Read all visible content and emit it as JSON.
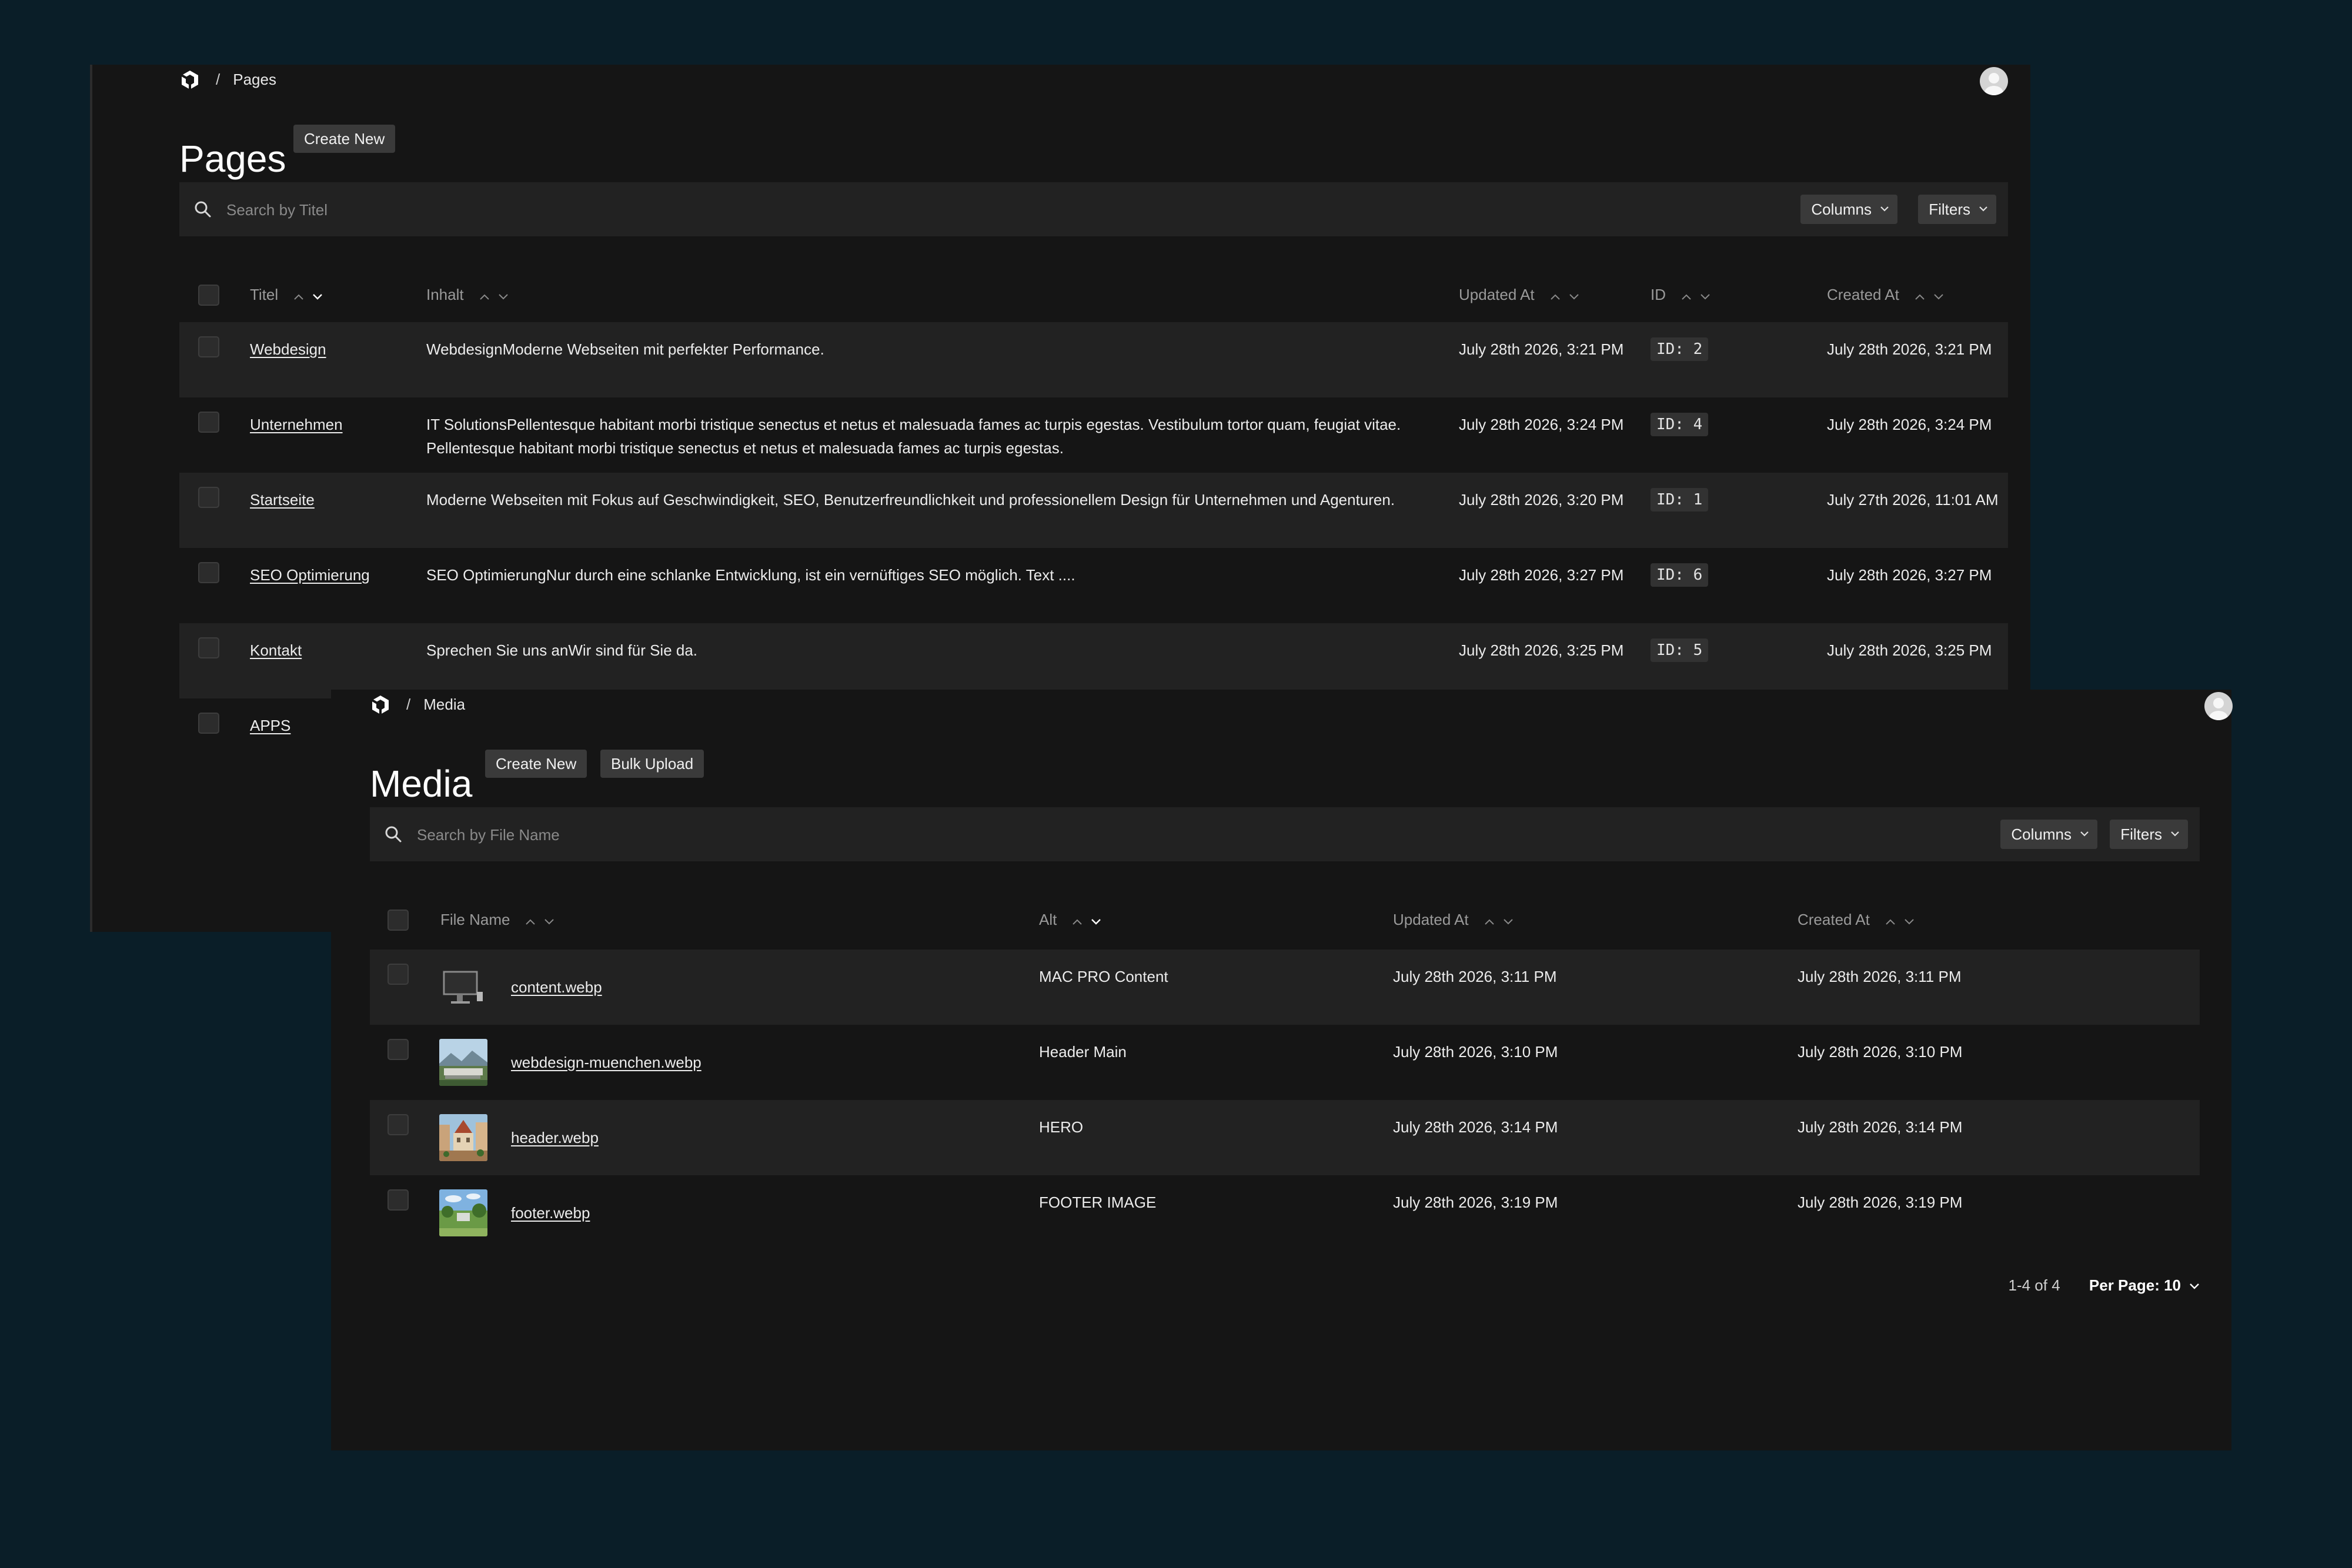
{
  "colors": {
    "background": "#0a1e28",
    "window": "#151515",
    "row_alt": "#222222",
    "button": "#3a3a3a",
    "muted_text": "#9a9a9a"
  },
  "pages": {
    "breadcrumb": {
      "separator": "/",
      "current": "Pages"
    },
    "title": "Pages",
    "create_label": "Create New",
    "search_placeholder": "Search by Titel",
    "columns_label": "Columns",
    "filters_label": "Filters",
    "headers": {
      "titel": "Titel",
      "inhalt": "Inhalt",
      "updated": "Updated At",
      "id": "ID",
      "created": "Created At"
    },
    "rows": [
      {
        "titel": "Webdesign",
        "inhalt": "WebdesignModerne Webseiten mit perfekter Performance.",
        "updated": "July 28th 2026, 3:21 PM",
        "id": "ID: 2",
        "created": "July 28th 2026, 3:21 PM"
      },
      {
        "titel": "Unternehmen",
        "inhalt": "IT SolutionsPellentesque habitant morbi tristique senectus et netus et malesuada fames ac turpis egestas. Vestibulum tortor quam, feugiat vitae. Pellentesque habitant morbi tristique senectus et netus et malesuada fames ac turpis egestas.",
        "updated": "July 28th 2026, 3:24 PM",
        "id": "ID: 4",
        "created": "July 28th 2026, 3:24 PM"
      },
      {
        "titel": "Startseite",
        "inhalt": "Moderne Webseiten mit Fokus auf Geschwindigkeit, SEO, Benutzerfreundlichkeit und professionellem Design für Unternehmen und Agenturen.",
        "updated": "July 28th 2026, 3:20 PM",
        "id": "ID: 1",
        "created": "July 27th 2026, 11:01 AM"
      },
      {
        "titel": "SEO Optimierung",
        "inhalt": "SEO OptimierungNur durch eine schlanke Entwicklung, ist ein vernüftiges SEO möglich. Text ....",
        "updated": "July 28th 2026, 3:27 PM",
        "id": "ID: 6",
        "created": "July 28th 2026, 3:27 PM"
      },
      {
        "titel": "Kontakt",
        "inhalt": "Sprechen Sie uns anWir sind für Sie da.",
        "updated": "July 28th 2026, 3:25 PM",
        "id": "ID: 5",
        "created": "July 28th 2026, 3:25 PM"
      },
      {
        "titel": "APPS"
      }
    ]
  },
  "media": {
    "breadcrumb": {
      "separator": "/",
      "current": "Media"
    },
    "title": "Media",
    "create_label": "Create New",
    "bulk_label": "Bulk Upload",
    "search_placeholder": "Search by File Name",
    "columns_label": "Columns",
    "filters_label": "Filters",
    "headers": {
      "file_name": "File Name",
      "alt": "Alt",
      "updated": "Updated At",
      "created": "Created At"
    },
    "rows": [
      {
        "file_name": "content.webp",
        "alt": "MAC PRO Content",
        "updated": "July 28th 2026, 3:11 PM",
        "created": "July 28th 2026, 3:11 PM",
        "thumb": "monitor-thumbnail"
      },
      {
        "file_name": "webdesign-muenchen.webp",
        "alt": "Header Main",
        "updated": "July 28th 2026, 3:10 PM",
        "created": "July 28th 2026, 3:10 PM",
        "thumb": "landscape-thumbnail"
      },
      {
        "file_name": "header.webp",
        "alt": "HERO",
        "updated": "July 28th 2026, 3:14 PM",
        "created": "July 28th 2026, 3:14 PM",
        "thumb": "city-thumbnail"
      },
      {
        "file_name": "footer.webp",
        "alt": "FOOTER IMAGE",
        "updated": "July 28th 2026, 3:19 PM",
        "created": "July 28th 2026, 3:19 PM",
        "thumb": "park-thumbnail"
      }
    ],
    "pagination": {
      "count": "1-4 of 4",
      "per_page": "Per Page: 10"
    }
  }
}
